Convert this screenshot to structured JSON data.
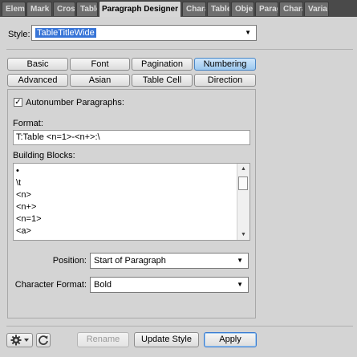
{
  "panel_tabs": [
    {
      "label": "Elem"
    },
    {
      "label": "Mark"
    },
    {
      "label": "Cross"
    },
    {
      "label": "Table"
    },
    {
      "label": "Paragraph Designer"
    },
    {
      "label": "Chara"
    },
    {
      "label": "Table"
    },
    {
      "label": "Obje"
    },
    {
      "label": "Parag"
    },
    {
      "label": "Chara"
    },
    {
      "label": "Varia"
    }
  ],
  "style": {
    "label": "Style:",
    "value": "TableTitleWide"
  },
  "tabs_row1": [
    "Basic",
    "Font",
    "Pagination",
    "Numbering"
  ],
  "tabs_row2": [
    "Advanced",
    "Asian",
    "Table Cell",
    "Direction"
  ],
  "active_tab": "Numbering",
  "autonumber": {
    "label": "Autonumber Paragraphs:",
    "checked": true
  },
  "format": {
    "label": "Format:",
    "value": "T:Table <n=1>-<n+>:\\"
  },
  "building_blocks": {
    "label": "Building Blocks:",
    "items": [
      "•",
      "\\t",
      "<n>",
      "<n+>",
      "<n=1>",
      "<a>"
    ]
  },
  "position": {
    "label": "Position:",
    "value": "Start of Paragraph"
  },
  "character_format": {
    "label": "Character Format:",
    "value": "Bold"
  },
  "buttons": {
    "rename": "Rename",
    "update_style": "Update Style",
    "apply": "Apply"
  },
  "icons": {
    "gear": "gear-icon",
    "refresh": "refresh-icon"
  }
}
